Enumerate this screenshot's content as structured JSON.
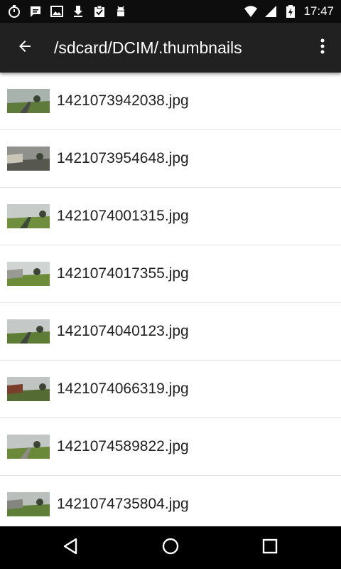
{
  "status_bar": {
    "time": "17:47",
    "left_icons": [
      "stopwatch-icon",
      "chat-bubble-icon",
      "image-icon",
      "download-icon",
      "clipboard-check-icon",
      "android-debug-icon"
    ],
    "right_icons": [
      "wifi-icon",
      "cell-signal-icon",
      "battery-charging-icon"
    ]
  },
  "toolbar": {
    "title": "/sdcard/DCIM/.thumbnails",
    "background": "#212121"
  },
  "files": [
    {
      "name": "1421073942038.jpg",
      "thumb_sky": "#a9b3ad",
      "thumb_ground": "#5f7b3c",
      "thumb_accent": "#4a4a48"
    },
    {
      "name": "1421073954648.jpg",
      "thumb_sky": "#8f918c",
      "thumb_ground": "#56574f",
      "thumb_accent": "#c9c6b8"
    },
    {
      "name": "1421074001315.jpg",
      "thumb_sky": "#c7ccc9",
      "thumb_ground": "#6f8e3e",
      "thumb_accent": "#3e4a36"
    },
    {
      "name": "1421074017355.jpg",
      "thumb_sky": "#d0d4d2",
      "thumb_ground": "#6c8c3a",
      "thumb_accent": "#9a9a94"
    },
    {
      "name": "1421074040123.jpg",
      "thumb_sky": "#c4c8c6",
      "thumb_ground": "#5d7d36",
      "thumb_accent": "#3f473a"
    },
    {
      "name": "1421074066319.jpg",
      "thumb_sky": "#bfc3c1",
      "thumb_ground": "#546b34",
      "thumb_accent": "#7a3e2c"
    },
    {
      "name": "1421074589822.jpg",
      "thumb_sky": "#c2c6c4",
      "thumb_ground": "#6a8a3a",
      "thumb_accent": "#8d8a84"
    },
    {
      "name": "1421074735804.jpg",
      "thumb_sky": "#b9bfbb",
      "thumb_ground": "#5f7f38",
      "thumb_accent": "#858580"
    }
  ],
  "nav_bar": {
    "icons": [
      "back-triangle-icon",
      "home-circle-icon",
      "recents-square-icon"
    ]
  }
}
